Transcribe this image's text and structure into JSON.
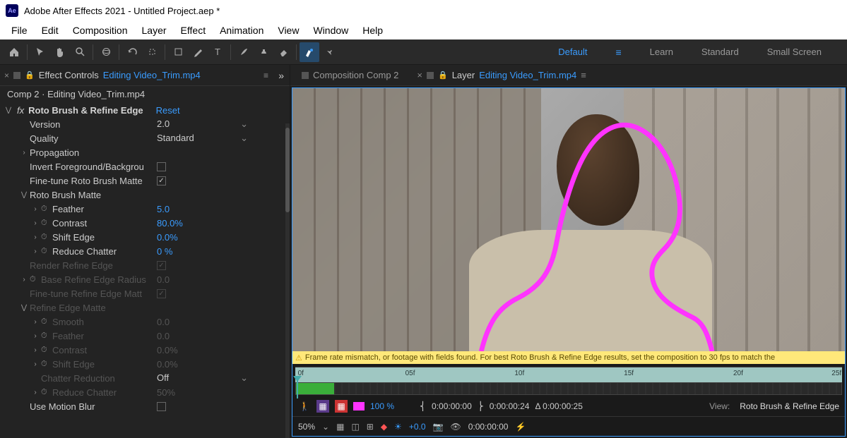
{
  "title": "Adobe After Effects 2021 - Untitled Project.aep *",
  "logo": "Ae",
  "menu": [
    "File",
    "Edit",
    "Composition",
    "Layer",
    "Effect",
    "Animation",
    "View",
    "Window",
    "Help"
  ],
  "workspaces": {
    "active": "Default",
    "items": [
      "Default",
      "Learn",
      "Standard",
      "Small Screen"
    ]
  },
  "effect_panel": {
    "tab_label": "Effect Controls",
    "tab_file": "Editing Video_Trim.mp4",
    "breadcrumb": "Comp 2 · Editing Video_Trim.mp4",
    "effect_name": "Roto Brush & Refine Edge",
    "reset": "Reset",
    "rows": [
      {
        "k": "version",
        "label": "Version",
        "val": "2.0",
        "type": "dd",
        "indent": 1
      },
      {
        "k": "quality",
        "label": "Quality",
        "val": "Standard",
        "type": "dd",
        "indent": 1
      },
      {
        "k": "propagation",
        "label": "Propagation",
        "type": "twirl-closed",
        "indent": 1
      },
      {
        "k": "invert",
        "label": "Invert Foreground/Backgrou",
        "type": "chk",
        "checked": false,
        "indent": 1
      },
      {
        "k": "finetune",
        "label": "Fine-tune Roto Brush Matte",
        "type": "chk",
        "checked": true,
        "indent": 1
      },
      {
        "k": "rbmatte",
        "label": "Roto Brush Matte",
        "type": "twirl-open",
        "indent": 1
      },
      {
        "k": "feather",
        "label": "Feather",
        "val": "5.0",
        "type": "num",
        "indent": 2,
        "sw": true
      },
      {
        "k": "contrast",
        "label": "Contrast",
        "val": "80.0%",
        "type": "num",
        "indent": 2,
        "sw": true
      },
      {
        "k": "shiftedge",
        "label": "Shift Edge",
        "val": "0.0%",
        "type": "num",
        "indent": 2,
        "sw": true
      },
      {
        "k": "reducechat",
        "label": "Reduce Chatter",
        "val": "0 %",
        "type": "num",
        "indent": 2,
        "sw": true
      },
      {
        "k": "renderref",
        "label": "Render Refine Edge",
        "type": "chk",
        "checked": true,
        "dim": true,
        "indent": 1
      },
      {
        "k": "baseref",
        "label": "Base Refine Edge Radius",
        "val": "0.0",
        "type": "num",
        "dim": true,
        "indent": 1,
        "sw": true
      },
      {
        "k": "finetuneref",
        "label": "Fine-tune Refine Edge Matt",
        "type": "chk",
        "checked": true,
        "dim": true,
        "indent": 1
      },
      {
        "k": "refmatte",
        "label": "Refine Edge Matte",
        "type": "twirl-open",
        "dim": true,
        "indent": 1
      },
      {
        "k": "smooth2",
        "label": "Smooth",
        "val": "0.0",
        "type": "num",
        "dim": true,
        "indent": 2,
        "sw": true
      },
      {
        "k": "feather2",
        "label": "Feather",
        "val": "0.0",
        "type": "num",
        "dim": true,
        "indent": 2,
        "sw": true
      },
      {
        "k": "contrast2",
        "label": "Contrast",
        "val": "0.0%",
        "type": "num",
        "dim": true,
        "indent": 2,
        "sw": true
      },
      {
        "k": "shiftedge2",
        "label": "Shift Edge",
        "val": "0.0%",
        "type": "num",
        "dim": true,
        "indent": 2,
        "sw": true
      },
      {
        "k": "chatred",
        "label": "Chatter Reduction",
        "val": "Off",
        "type": "dd",
        "dim": true,
        "indent": 2
      },
      {
        "k": "reducechat2",
        "label": "Reduce Chatter",
        "val": "50%",
        "type": "num",
        "dim": true,
        "indent": 2,
        "sw": true
      },
      {
        "k": "motionblur",
        "label": "Use Motion Blur",
        "type": "chk",
        "checked": false,
        "dim": false,
        "indent": 1
      }
    ]
  },
  "viewer": {
    "tabs": [
      {
        "label": "Composition Comp 2",
        "file": null,
        "active": false
      },
      {
        "label": "Layer",
        "file": "Editing Video_Trim.mp4",
        "active": true
      }
    ],
    "warning": "Frame rate mismatch, or footage with fields found. For best Roto Brush & Refine Edge results, set the composition to 30 fps to match the",
    "frames": [
      "0f",
      "05f",
      "10f",
      "15f",
      "20f",
      "25f"
    ],
    "roto_ctrl": {
      "zoom": "100 %",
      "in": "0:00:00:00",
      "out": "0:00:00:24",
      "dur": "Δ 0:00:00:25",
      "view_label": "View:",
      "view": "Roto Brush & Refine Edge"
    },
    "bottom": {
      "mag": "50%",
      "exposure": "+0.0",
      "time": "0:00:00:00"
    }
  }
}
